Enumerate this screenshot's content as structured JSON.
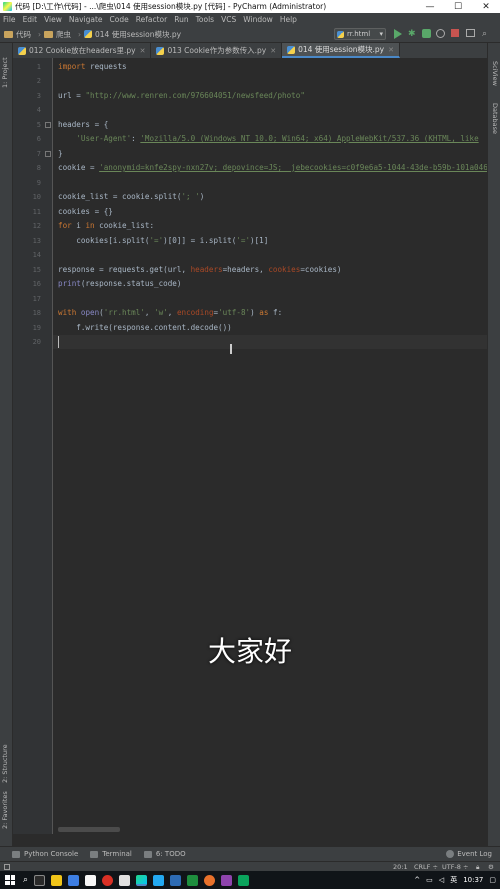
{
  "window": {
    "title": "代码 [D:\\工作\\代码] - ...\\爬虫\\014 使用session模块.py [代码] - PyCharm (Administrator)",
    "minimize": "—",
    "maximize": "☐",
    "close": "✕"
  },
  "menu": [
    "File",
    "Edit",
    "View",
    "Navigate",
    "Code",
    "Refactor",
    "Run",
    "Tools",
    "VCS",
    "Window",
    "Help"
  ],
  "breadcrumbs": [
    "代码",
    "爬虫",
    "014 使用session模块.py"
  ],
  "run_config": "rr.html",
  "tabs": [
    {
      "label": "012 Cookie放在headers里.py",
      "active": false
    },
    {
      "label": "013 Cookie作为参数传入.py",
      "active": false
    },
    {
      "label": "014 使用session模块.py",
      "active": true
    }
  ],
  "left_panels": [
    "1: Project",
    "2: Structure",
    "2: Favorites"
  ],
  "right_panels": [
    "SciView",
    "Database"
  ],
  "code": {
    "line_numbers": [
      "1",
      "2",
      "3",
      "4",
      "5",
      "6",
      "7",
      "8",
      "9",
      "10",
      "11",
      "12",
      "13",
      "14",
      "15",
      "16",
      "17",
      "18",
      "19",
      "20"
    ],
    "l1_kw": "import",
    "l1_rest": " requests",
    "l3_a": "url = ",
    "l3_str": "\"http://www.renren.com/976604051/newsfeed/photo\"",
    "l5": "headers = {",
    "l6_key": "'User-Agent'",
    "l6_colon": ": ",
    "l6_val": "'Mozilla/5.0 (Windows NT 10.0; Win64; x64) AppleWebKit/537.36 (KHTML, like",
    "l7": "}",
    "l8_a": "cookie = ",
    "l8_str": "'anonymid=knfe2spy-nxn27v; depovince=JS; _jebecookies=c0f9e6a5-1044-43de-b59b-101a046",
    "l10_a": "cookie_list = cookie.split(",
    "l10_str": "'; '",
    "l10_b": ")",
    "l11": "cookies = {}",
    "l12_kw1": "for",
    "l12_a": " i ",
    "l12_kw2": "in",
    "l12_b": " cookie_list:",
    "l13_a": "    cookies[i.split(",
    "l13_s1": "'='",
    "l13_b": ")[0]] = i.split(",
    "l13_s2": "'='",
    "l13_c": ")[1]",
    "l15_a": "response = requests.get(url, ",
    "l15_k1": "headers",
    "l15_b": "=headers, ",
    "l15_k2": "cookies",
    "l15_c": "=cookies)",
    "l16_b": "print",
    "l16_rest": "(response.status_code)",
    "l18_kw": "with",
    "l18_a": " ",
    "l18_b": "open",
    "l18_c": "(",
    "l18_s1": "'rr.html'",
    "l18_d": ", ",
    "l18_s2": "'w'",
    "l18_e": ", ",
    "l18_k": "encoding",
    "l18_f": "=",
    "l18_s3": "'utf-8'",
    "l18_g": ") ",
    "l18_kw2": "as",
    "l18_h": " f:",
    "l19": "    f.write(response.content.decode())"
  },
  "subtitle": "大家好",
  "bottom_tools": [
    "Python Console",
    "Terminal",
    "6: TODO"
  ],
  "event_log": "Event Log",
  "status": {
    "position": "20:1",
    "line_sep": "CRLF ÷",
    "encoding": "UTF-8 ÷"
  },
  "taskbar": {
    "time": "10:37",
    "ime": "英"
  },
  "colors": {
    "keyword": "#cc7832",
    "string": "#6a8759",
    "kwarg": "#aa4926",
    "builtin": "#8888c6",
    "text": "#a9b7c6",
    "background": "#2b2b2b"
  }
}
